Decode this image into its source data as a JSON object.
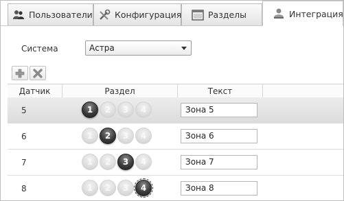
{
  "tabs": [
    {
      "label": "Пользователи",
      "icon": "users-icon"
    },
    {
      "label": "Конфигурация",
      "icon": "tools-icon"
    },
    {
      "label": "Разделы",
      "icon": "sections-icon"
    },
    {
      "label": "Интеграция",
      "icon": "integration-icon",
      "active": true
    }
  ],
  "system": {
    "label": "Система",
    "value": "Астра"
  },
  "toolbar": {
    "add_icon": "plus-icon",
    "remove_icon": "remove-icon"
  },
  "grid": {
    "columns": [
      "Датчик",
      "Раздел",
      "Текст"
    ],
    "partition_numbers": [
      "1",
      "2",
      "3",
      "4"
    ],
    "rows": [
      {
        "sensor": "5",
        "partition": 1,
        "text": "Зона 5",
        "selected": true
      },
      {
        "sensor": "6",
        "partition": 2,
        "text": "Зона 6"
      },
      {
        "sensor": "7",
        "partition": 3,
        "text": "Зона 7"
      },
      {
        "sensor": "8",
        "partition": 4,
        "text": "Зона 8"
      }
    ]
  }
}
